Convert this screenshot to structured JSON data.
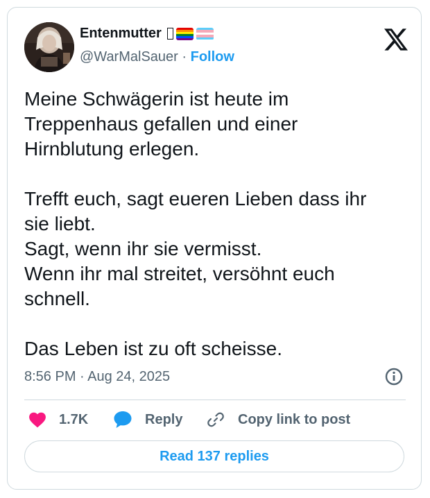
{
  "author": {
    "display_name": "Entenmutter",
    "handle": "@WarMalSauer",
    "separator": "·",
    "follow_label": "Follow"
  },
  "tweet": {
    "paragraphs": [
      [
        "Meine Schwägerin ist heute im",
        "Treppenhaus gefallen und einer",
        "Hirnblutung erlegen."
      ],
      [
        "Trefft euch, sagt eueren Lieben dass ihr",
        "sie liebt.",
        "Sagt, wenn ihr sie vermisst.",
        "Wenn ihr mal streitet, versöhnt euch",
        "schnell."
      ],
      [
        "Das Leben ist zu oft scheisse."
      ]
    ],
    "timestamp": "8:56 PM · Aug 24, 2025"
  },
  "actions": {
    "like_count": "1.7K",
    "reply_label": "Reply",
    "copy_link_label": "Copy link to post",
    "read_replies_label": "Read 137 replies"
  },
  "icons": {
    "logo": "x-logo-icon",
    "info": "info-icon",
    "like": "heart-icon",
    "reply": "speech-bubble-icon",
    "copy": "link-icon"
  },
  "colors": {
    "accent": "#1d9bf0",
    "like": "#f91880",
    "muted": "#536471",
    "text": "#0f1419",
    "border": "#cfd9de"
  }
}
